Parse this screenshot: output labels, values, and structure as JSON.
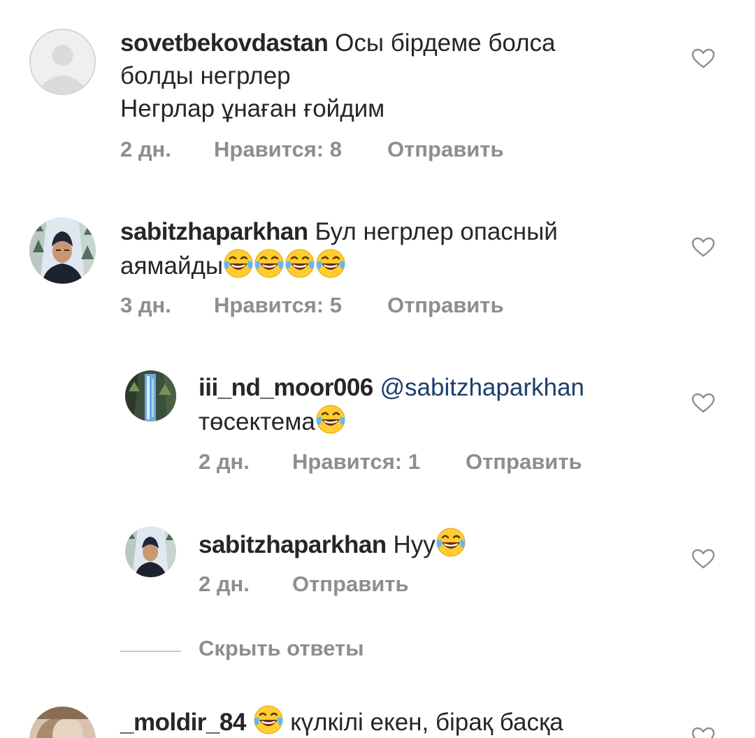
{
  "comments": [
    {
      "username": "sovetbekovdastan",
      "lines": [
        "Осы бірдеме болса",
        "болды негрлер",
        "Негрлар ұнаған ғойдим"
      ],
      "time": "2 дн.",
      "likes": "Нравится: 8",
      "reply": "Отправить"
    },
    {
      "username": "sabitzhaparkhan",
      "lines": [
        "Бул негрлер опасный",
        "аямайды"
      ],
      "emoji_count": 4,
      "time": "3 дн.",
      "likes": "Нравится: 5",
      "reply": "Отправить"
    },
    {
      "username": "iii_nd_moor006",
      "mention": "@sabitzhaparkhan",
      "lines": [
        "төсектема"
      ],
      "time": "2 дн.",
      "likes": "Нравится: 1",
      "reply": "Отправить"
    },
    {
      "username": "sabitzhaparkhan",
      "lines": [
        "Нуу"
      ],
      "time": "2 дн.",
      "reply": "Отправить"
    },
    {
      "username": "_moldir_84",
      "lines": [
        "күлкілі екен, бірақ басқа"
      ]
    }
  ],
  "hide_replies": "Скрыть ответы",
  "icons": {
    "heart": "heart-outline-icon",
    "emoji": "face-with-tears-of-joy-emoji"
  },
  "colors": {
    "text": "#262626",
    "secondary": "#8e8e8e",
    "mention": "#1c3d6e",
    "divider": "#c7c7c7"
  }
}
